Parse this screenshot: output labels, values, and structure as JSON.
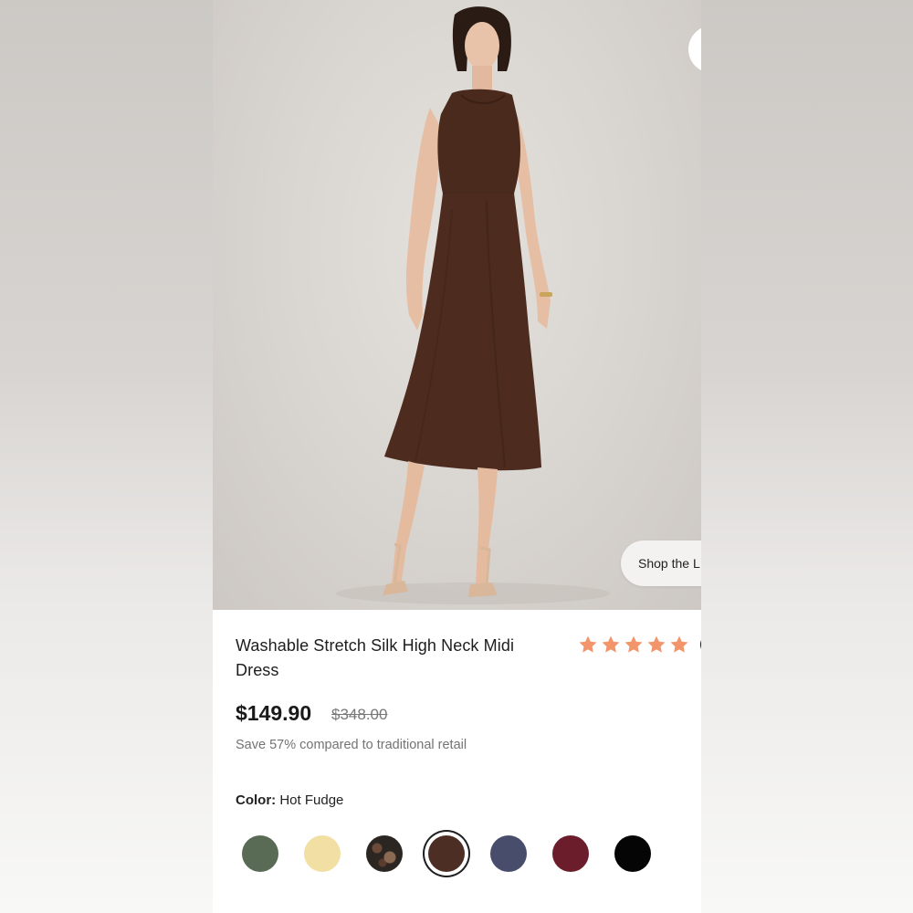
{
  "shop_pill": {
    "label": "Shop the L"
  },
  "product": {
    "title": "Washable Stretch Silk High Neck Midi Dress",
    "rating_stars": 5,
    "rating_fragment": "(",
    "price": "$149.90",
    "compare_price": "$348.00",
    "savings_text": "Save 57% compared to traditional retail",
    "color_label": "Color:",
    "color_value": "Hot Fudge"
  },
  "colors": {
    "star": "#f2956b",
    "dress": "#4a2a1d",
    "background": "#d8d4d0"
  },
  "swatches": [
    {
      "name": "green",
      "color": "#5a6b55",
      "selected": false
    },
    {
      "name": "cream",
      "color": "#f1dfa4",
      "selected": false
    },
    {
      "name": "floral-print",
      "color": "#2b2622",
      "selected": false
    },
    {
      "name": "hot-fudge",
      "color": "#4d2e24",
      "selected": true
    },
    {
      "name": "navy",
      "color": "#494d6c",
      "selected": false
    },
    {
      "name": "burgundy",
      "color": "#6b1d2c",
      "selected": false
    },
    {
      "name": "black",
      "color": "#050505",
      "selected": false
    }
  ]
}
